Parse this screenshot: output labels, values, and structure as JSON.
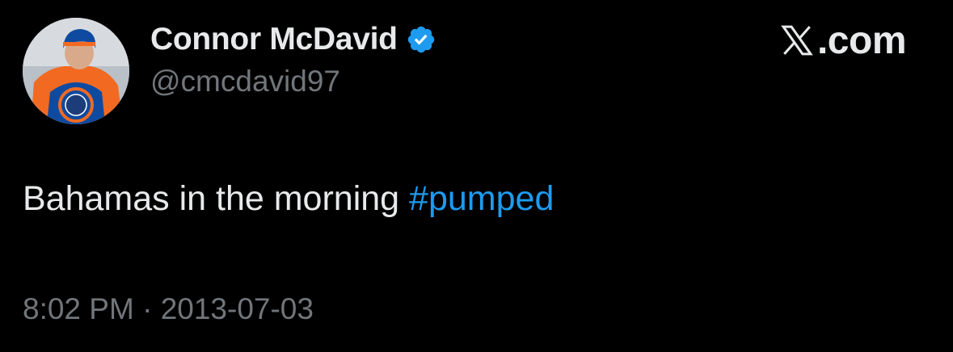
{
  "author": {
    "display_name": "Connor McDavid",
    "handle": "@cmcdavid97",
    "verified": true,
    "avatar_icon": "profile-photo-hockey-player"
  },
  "brand": {
    "x_glyph": "𝕏",
    "text": ".com"
  },
  "tweet": {
    "text": "Bahamas in the morning ",
    "hashtag": "#pumped"
  },
  "meta": {
    "time": "8:02 PM",
    "separator": "·",
    "date": "2013-07-03"
  },
  "colors": {
    "background": "#000000",
    "text_primary": "#e7e9ea",
    "text_secondary": "#71767b",
    "accent": "#1d9bf0"
  }
}
